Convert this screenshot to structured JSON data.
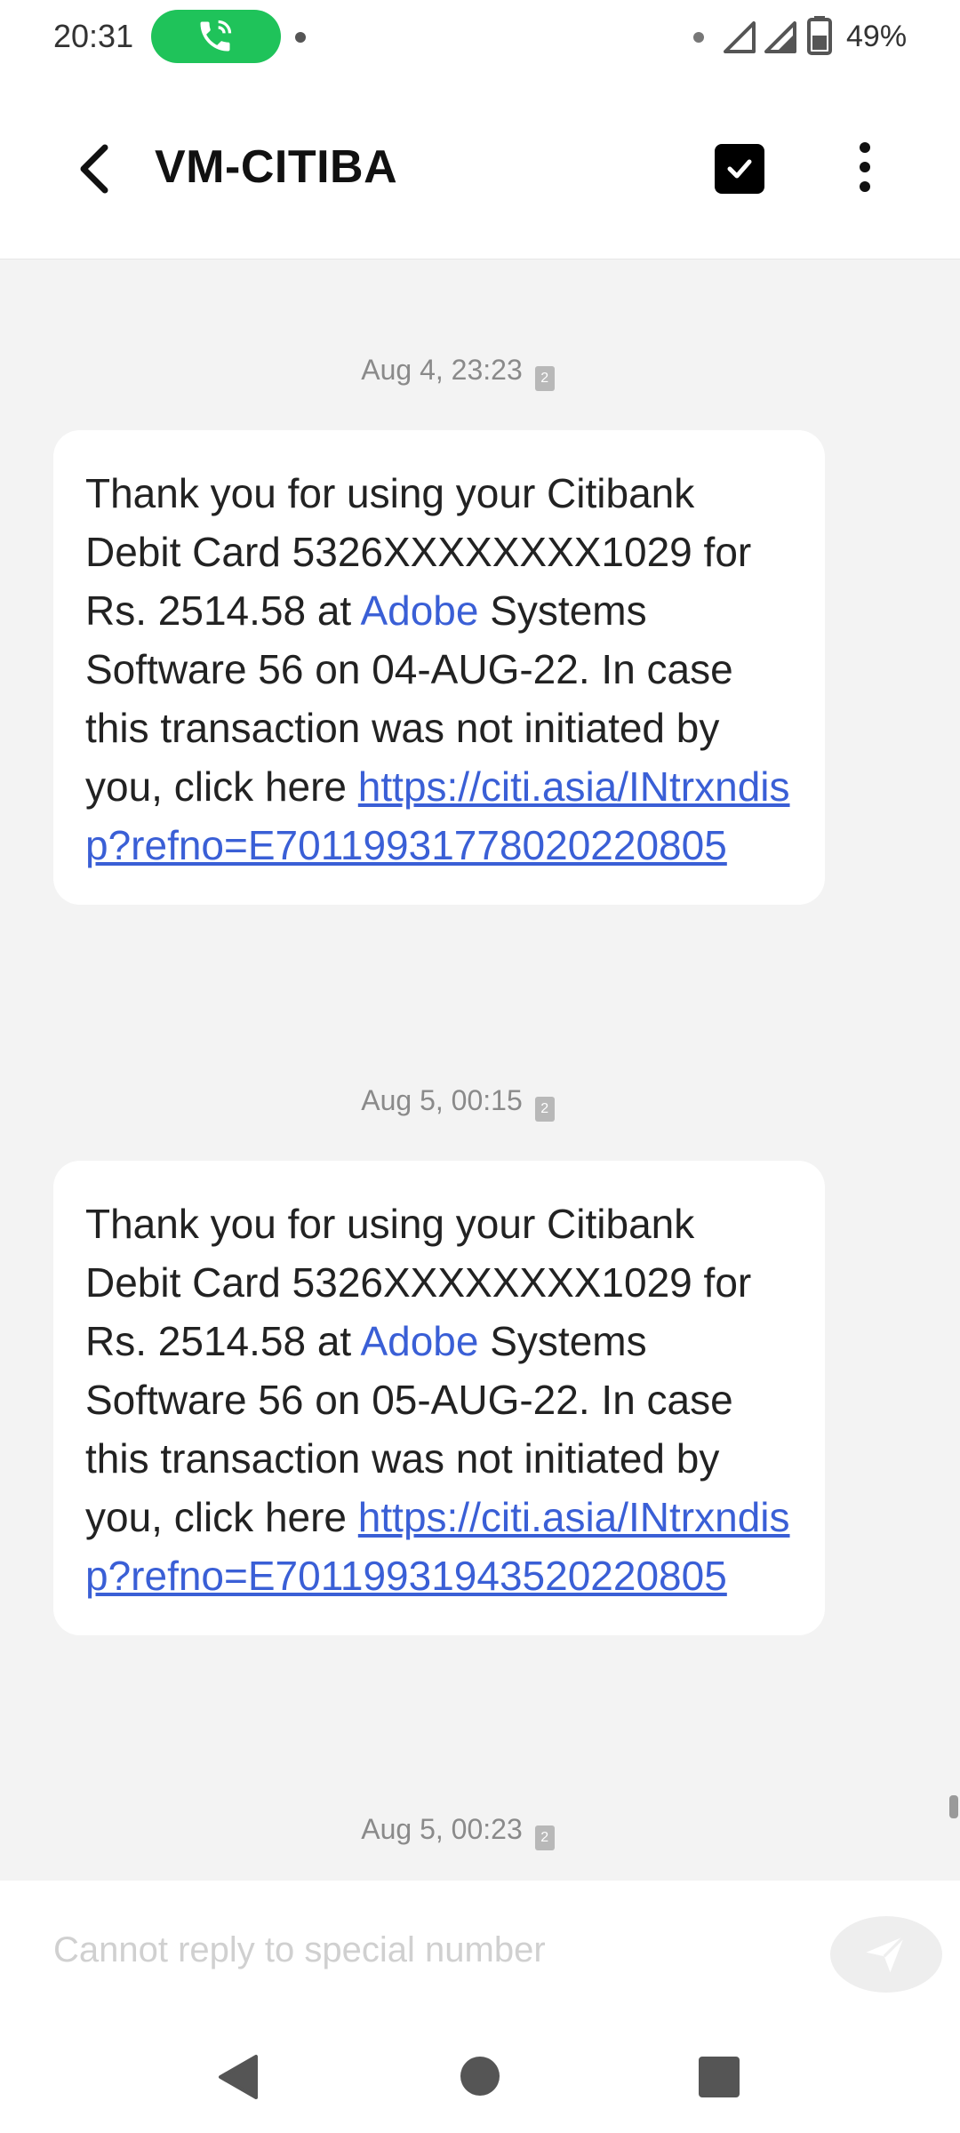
{
  "status_bar": {
    "time": "20:31",
    "battery": "49%",
    "icons": [
      "call-icon",
      "notification-dot-icon",
      "signal-icon",
      "signal-icon",
      "battery-icon"
    ]
  },
  "header": {
    "title": "VM-CITIBA",
    "icons": [
      "back-arrow-icon",
      "select-checkbox-icon",
      "more-options-icon"
    ]
  },
  "messages": [
    {
      "timestamp": "Aug 4, 23:23",
      "sim": "2",
      "text_before": "Thank you for using your Citibank Debit Card 5326XXXXXXXX1029 for Rs. 2514.58 at ",
      "link_word": "Adobe",
      "text_after": " Systems Software 56 on 04-AUG-22.  In case this transaction was not initiated by you, click here ",
      "url": "https://citi.asia/INtrxndisp?refno=E70119931778020220805"
    },
    {
      "timestamp": "Aug 5, 00:15",
      "sim": "2",
      "text_before": "Thank you for using your Citibank Debit Card 5326XXXXXXXX1029 for Rs. 2514.58 at ",
      "link_word": "Adobe",
      "text_after": " Systems Software 56 on 05-AUG-22.  In case this transaction was not initiated by you, click here ",
      "url": "https://citi.asia/INtrxndisp?refno=E70119931943520220805"
    },
    {
      "timestamp": "Aug 5, 00:23",
      "sim": "2"
    }
  ],
  "reply": {
    "placeholder": "Cannot reply to special number",
    "send_icon": "send-icon"
  },
  "nav": {
    "icons": [
      "nav-back-icon",
      "nav-home-icon",
      "nav-recents-icon"
    ]
  },
  "colors": {
    "call_pill": "#1fc35a",
    "link": "#3a5fd6",
    "conversation_bg": "#f3f3f3"
  }
}
